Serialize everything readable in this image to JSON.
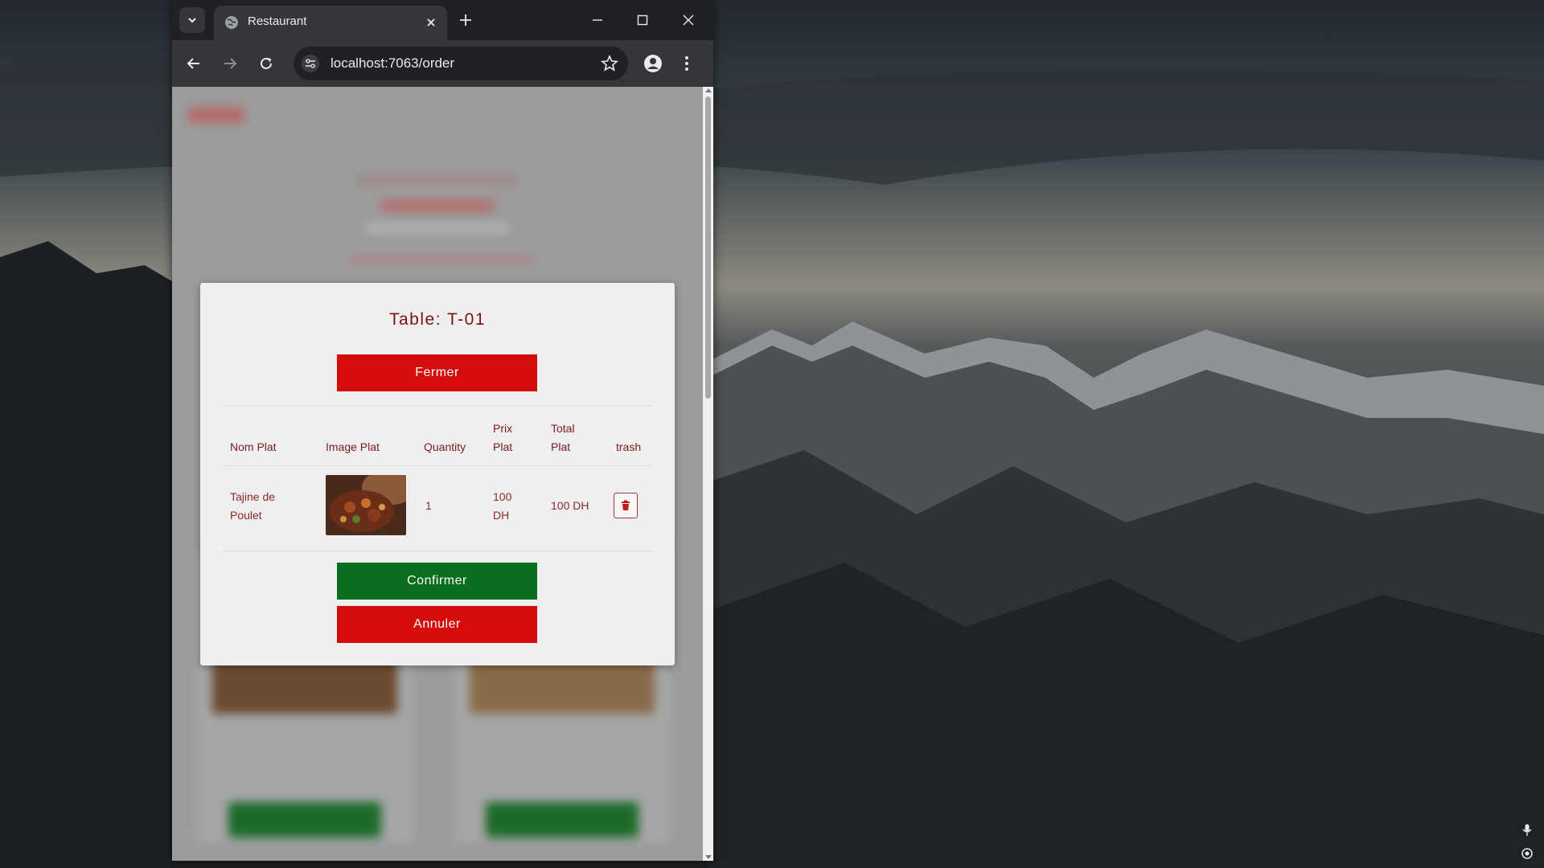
{
  "browser": {
    "tab_title": "Restaurant",
    "url": "localhost:7063/order"
  },
  "modal": {
    "title": "Table: T-01",
    "close_label": "Fermer",
    "confirm_label": "Confirmer",
    "cancel_label": "Annuler",
    "columns": {
      "name": "Nom Plat",
      "image": "Image Plat",
      "quantity": "Quantity",
      "price_line1": "Prix",
      "price_line2": "Plat",
      "total_line1": "Total",
      "total_line2": "Plat",
      "trash": "trash"
    },
    "rows": [
      {
        "name_line1": "Tajine de",
        "name_line2": "Poulet",
        "quantity": "1",
        "price_line1": "100",
        "price_line2": "DH",
        "total": "100 DH"
      }
    ]
  },
  "colors": {
    "accent_red": "#d40c0c",
    "confirm_green": "#0b6d1e",
    "text_dark_red": "#7a1212"
  },
  "icons": [
    "tab-search-icon",
    "globe-icon",
    "close-icon",
    "plus-icon",
    "minimize-icon",
    "maximize-icon",
    "back-icon",
    "forward-icon",
    "reload-icon",
    "site-settings-icon",
    "star-icon",
    "profile-icon",
    "menu-icon",
    "trash-icon",
    "microphone-icon",
    "location-icon"
  ]
}
